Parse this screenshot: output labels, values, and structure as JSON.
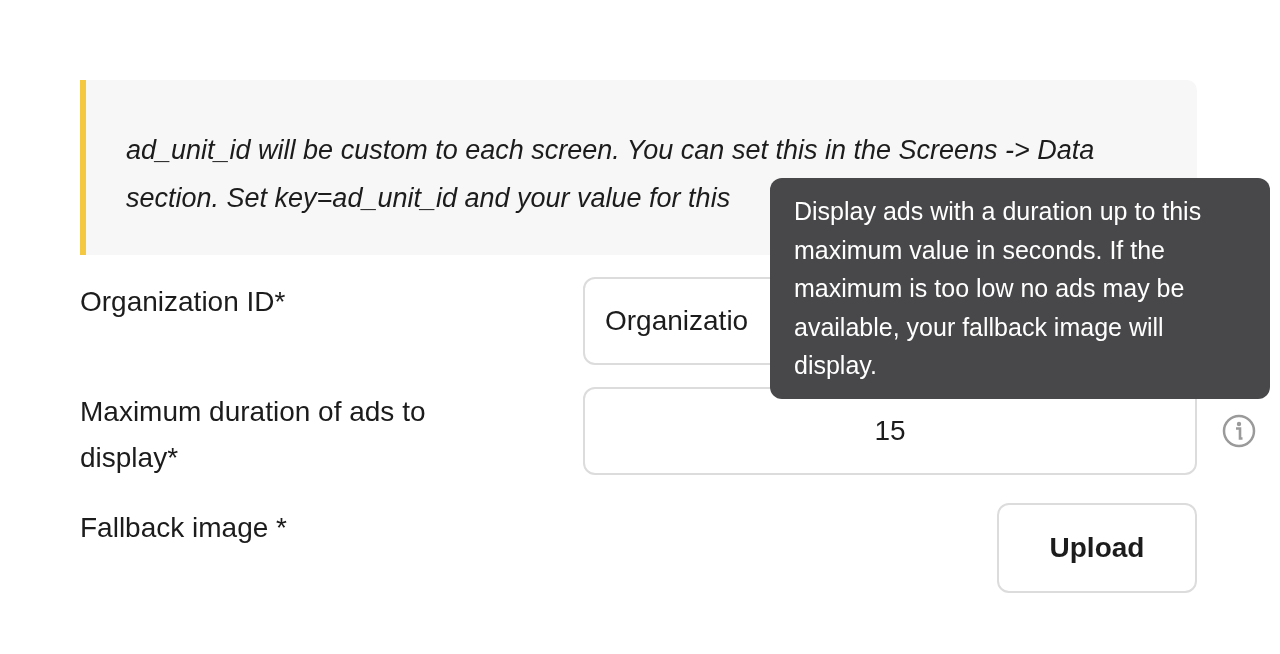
{
  "note": {
    "lines": [
      "ad_unit_id will be custom to each screen. You can set this in the Screens -> Data",
      "section. Set key=ad_unit_id and your value for this"
    ]
  },
  "fields": [
    {
      "kind": "text",
      "label": "Organization ID*",
      "value": "Organizatio",
      "info": false
    },
    {
      "kind": "number",
      "label": "Maximum duration of ads to display*",
      "value": "15",
      "info": true
    },
    {
      "kind": "upload",
      "label": "Fallback image *",
      "button": "Upload",
      "info": false
    }
  ],
  "tooltip": {
    "text": "Display ads with a duration up to this maximum value in seconds. If the maximum is too low no ads may be available, your fallback image will display."
  }
}
